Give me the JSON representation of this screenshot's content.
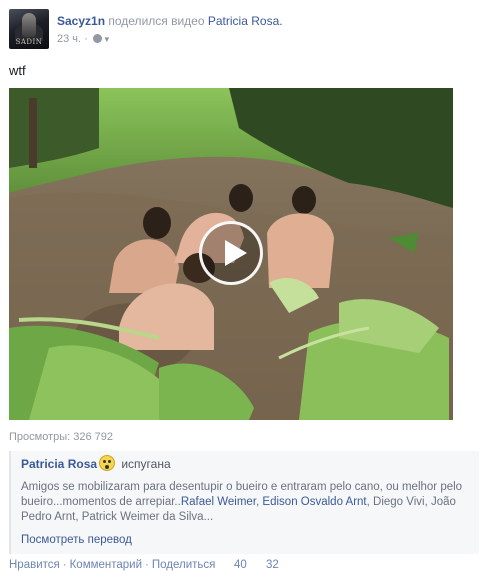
{
  "post": {
    "author": "Sacyz1n",
    "action_text": "поделился видео",
    "shared_from": "Patricia Rosa.",
    "timestamp": "23 ч.",
    "separator": "·",
    "message": "wtf",
    "avatar_text": "SADIN"
  },
  "video": {
    "views_label": "Просмотры: 326 792"
  },
  "quote": {
    "author": "Patricia Rosa",
    "feeling": "испугана",
    "body_prefix": "Amigos se mobilizaram para desentupir o bueiro e entraram pelo cano, ou melhor pelo bueiro...momentos de arrepiar..",
    "tags": [
      "Rafael Weimer",
      "Edison Osvaldo Arnt"
    ],
    "body_suffix": ", Diego Vivi, João Pedro Arnt, Patrick Weimer da Silva...",
    "see_translation": "Посмотреть перевод"
  },
  "actions": {
    "like": "Нравится",
    "comment": "Комментарий",
    "share": "Поделиться",
    "sep": "·",
    "like_count": "40",
    "share_count": "32"
  },
  "colors": {
    "link": "#3b5998",
    "muted": "#9197a3",
    "quote_bg": "#f6f7f9"
  }
}
